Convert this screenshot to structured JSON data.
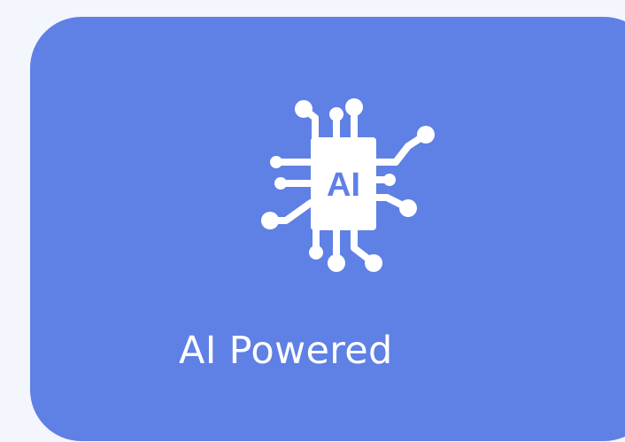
{
  "card": {
    "icon": "ai-chip-icon",
    "icon_text": "AI",
    "label": "AI Powered"
  },
  "colors": {
    "background": "#f3f6fd",
    "card": "#5f80e4",
    "foreground": "#ffffff"
  }
}
